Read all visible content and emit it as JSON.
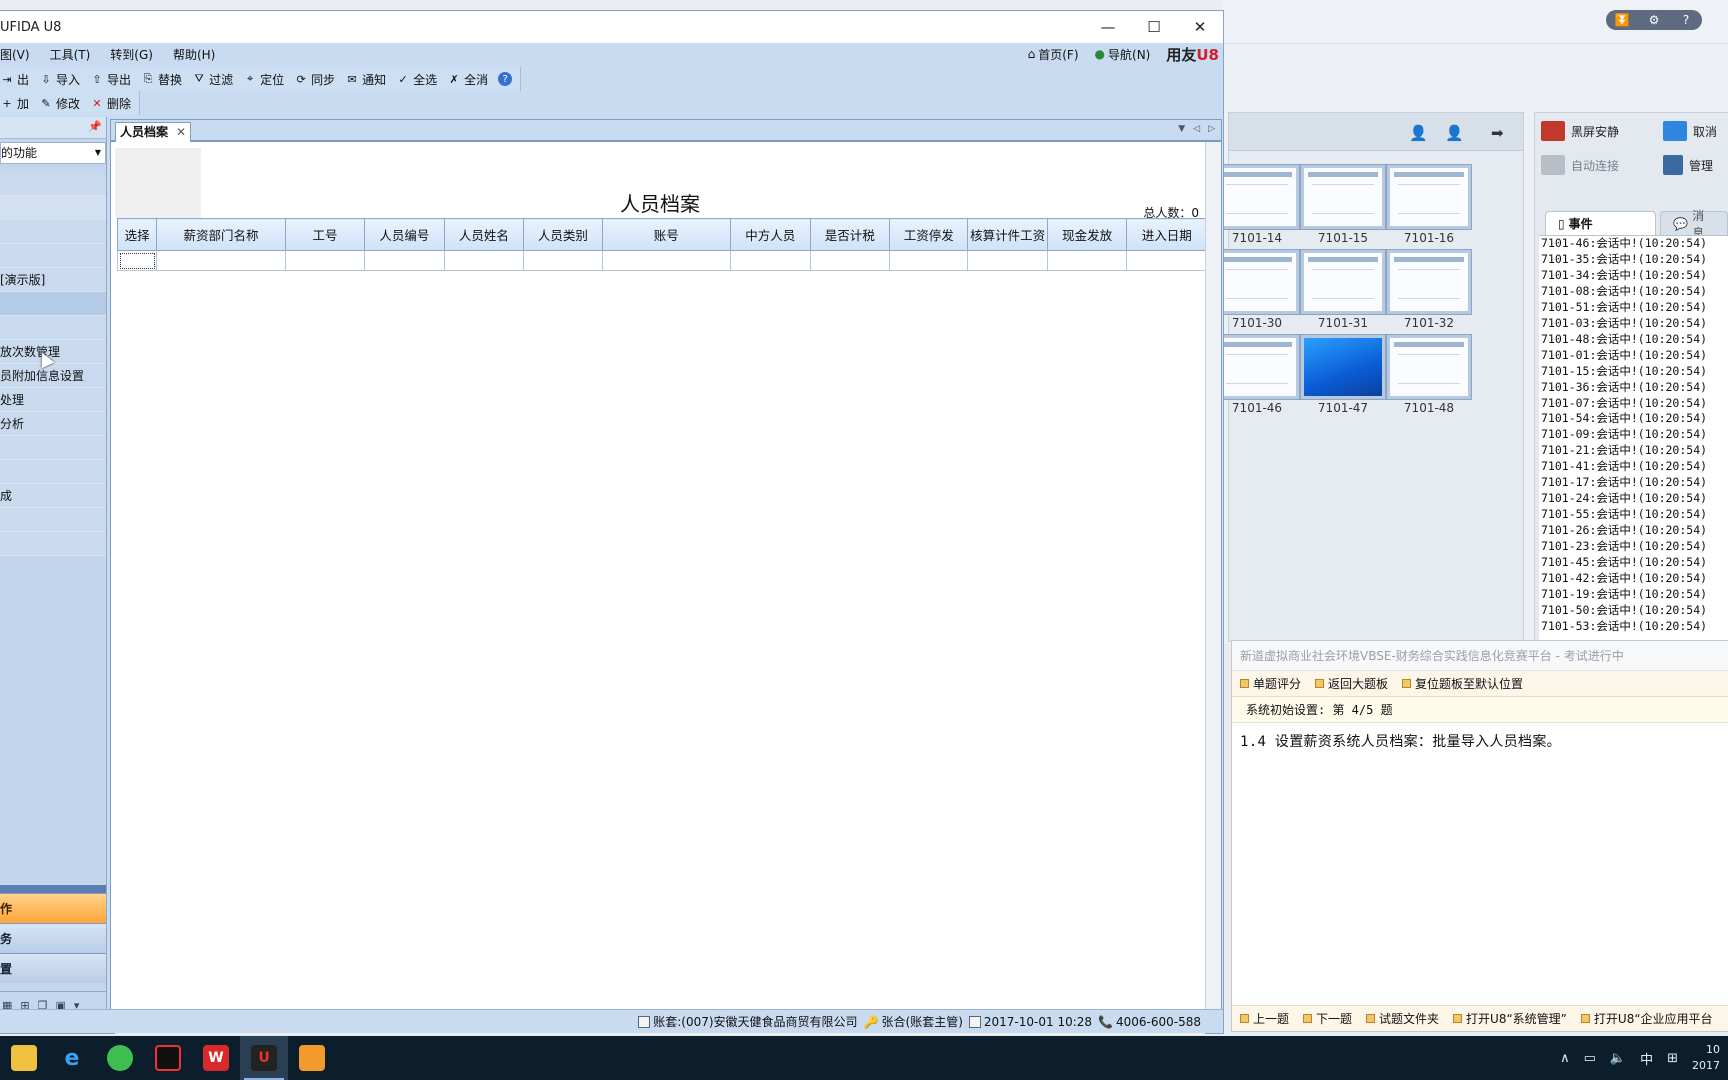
{
  "u8": {
    "title": "UFIDA U8",
    "menus": [
      "图(V)",
      "工具(T)",
      "转到(G)",
      "帮助(H)"
    ],
    "home_label": "首页(F)",
    "nav_label": "导航(N)",
    "brand_text": "用友",
    "brand_mark": "U8",
    "toolbar1": [
      {
        "label": "出",
        "icon": "export-partial-icon"
      },
      {
        "label": "导入",
        "icon": "import-icon"
      },
      {
        "label": "导出",
        "icon": "export-icon"
      },
      {
        "label": "替换",
        "icon": "replace-icon"
      },
      {
        "label": "过滤",
        "icon": "filter-icon"
      },
      {
        "label": "定位",
        "icon": "locate-icon"
      },
      {
        "label": "同步",
        "icon": "sync-icon"
      },
      {
        "label": "通知",
        "icon": "notify-icon"
      },
      {
        "label": "全选",
        "icon": "select-all-icon"
      },
      {
        "label": "全消",
        "icon": "deselect-all-icon"
      }
    ],
    "toolbar2": [
      {
        "label": "加",
        "icon": "add-icon"
      },
      {
        "label": "修改",
        "icon": "edit-icon"
      },
      {
        "label": "删除",
        "icon": "delete-icon"
      }
    ]
  },
  "leftnav": {
    "combo_value": "的功能",
    "tree": [
      "",
      "",
      "",
      "",
      "[演示版]",
      "",
      "",
      "放次数管理",
      "员附加信息设置",
      "处理",
      "分析",
      "",
      "",
      "成",
      "",
      ""
    ],
    "nav_buttons": [
      "作",
      "务",
      "置"
    ]
  },
  "doc": {
    "tab_label": "人员档案",
    "tab_close": "✕",
    "title": "人员档案",
    "total_label": "总人数：0",
    "columns": [
      "选择",
      "薪资部门名称",
      "工号",
      "人员编号",
      "人员姓名",
      "人员类别",
      "账号",
      "中方人员",
      "是否计税",
      "工资停发",
      "核算计件工资",
      "现金发放",
      "进入日期"
    ]
  },
  "status": {
    "account": "账套:(007)安徽天健食品商贸有限公司",
    "user": "张合(账套主管)",
    "datetime": "2017-10-01 10:28",
    "phone": "4006-600-588"
  },
  "thumbs": [
    "7101-14",
    "7101-15",
    "7101-16",
    "7101-30",
    "7101-31",
    "7101-32",
    "7101-46",
    "7101-47",
    "7101-48"
  ],
  "ctrl": {
    "black_screen": "黑屏安静",
    "cancel": "取消",
    "auto_connect": "自动连接",
    "manage": "管理",
    "tab_events": "事件",
    "tab_messages": "消息"
  },
  "events": [
    "7101-46:会话中!(10:20:54)",
    "7101-35:会话中!(10:20:54)",
    "7101-34:会话中!(10:20:54)",
    "7101-08:会话中!(10:20:54)",
    "7101-51:会话中!(10:20:54)",
    "7101-03:会话中!(10:20:54)",
    "7101-48:会话中!(10:20:54)",
    "7101-01:会话中!(10:20:54)",
    "7101-15:会话中!(10:20:54)",
    "7101-36:会话中!(10:20:54)",
    "7101-07:会话中!(10:20:54)",
    "7101-54:会话中!(10:20:54)",
    "7101-09:会话中!(10:20:54)",
    "7101-21:会话中!(10:20:54)",
    "7101-41:会话中!(10:20:54)",
    "7101-17:会话中!(10:20:54)",
    "7101-24:会话中!(10:20:54)",
    "7101-55:会话中!(10:20:54)",
    "7101-26:会话中!(10:20:54)",
    "7101-23:会话中!(10:20:54)",
    "7101-45:会话中!(10:20:54)",
    "7101-42:会话中!(10:20:54)",
    "7101-19:会话中!(10:20:54)",
    "7101-50:会话中!(10:20:54)",
    "7101-53:会话中!(10:20:54)"
  ],
  "exam": {
    "window_title": "新道虚拟商业社会环境VBSE-财务综合实践信息化竞赛平台 - 考试进行中",
    "tools": [
      "单题评分",
      "返回大题板",
      "复位题板至默认位置"
    ],
    "progress": "系统初始设置: 第 4/5 题",
    "question": "1.4 设置薪资系统人员档案：批量导入人员档案。",
    "bottom": [
      "上一题",
      "下一题",
      "试题文件夹",
      "打开U8“系统管理”",
      "打开U8“企业应用平台"
    ]
  },
  "taskbar": {
    "apps": [
      "file-explorer-icon",
      "ie-icon",
      "browser-icon",
      "recorder-icon",
      "wps-icon",
      "u8-icon",
      "app-icon"
    ],
    "ime": "中",
    "clock_time": "10",
    "clock_date": "2017"
  },
  "colors": {
    "u8_frame": "#c9dbf0",
    "accent_orange": "#ffa63a",
    "brand_red": "#d0202a"
  }
}
